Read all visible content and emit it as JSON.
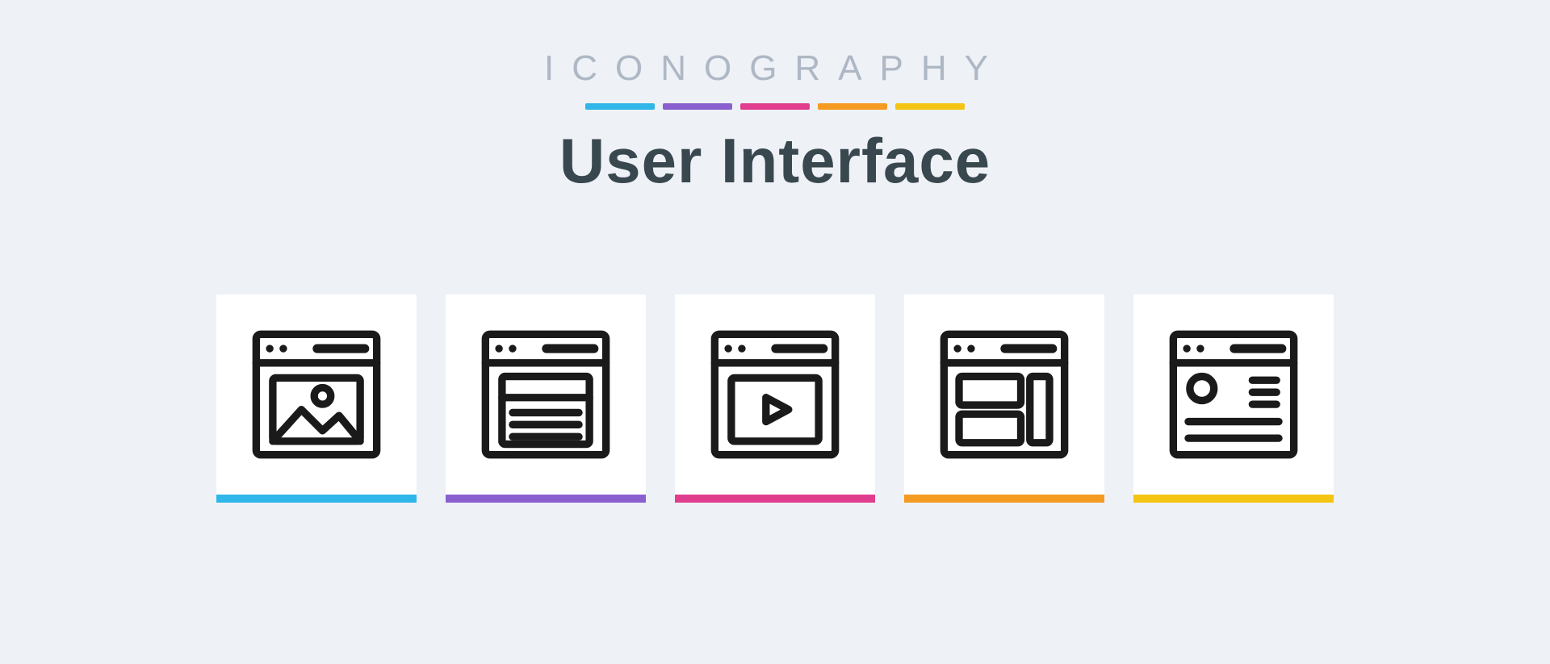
{
  "header": {
    "brand": "ICONOGRAPHY",
    "title": "User Interface"
  },
  "palette": {
    "c1": "#30b6e8",
    "c2": "#8a60d0",
    "c3": "#e13d8f",
    "c4": "#f59b22",
    "c5": "#f4c414"
  },
  "icons": [
    {
      "name": "browser-image-icon",
      "underline": "#30b6e8"
    },
    {
      "name": "browser-text-icon",
      "underline": "#8a60d0"
    },
    {
      "name": "browser-video-icon",
      "underline": "#e13d8f"
    },
    {
      "name": "browser-layout-icon",
      "underline": "#f59b22"
    },
    {
      "name": "browser-profile-icon",
      "underline": "#f4c414"
    }
  ]
}
